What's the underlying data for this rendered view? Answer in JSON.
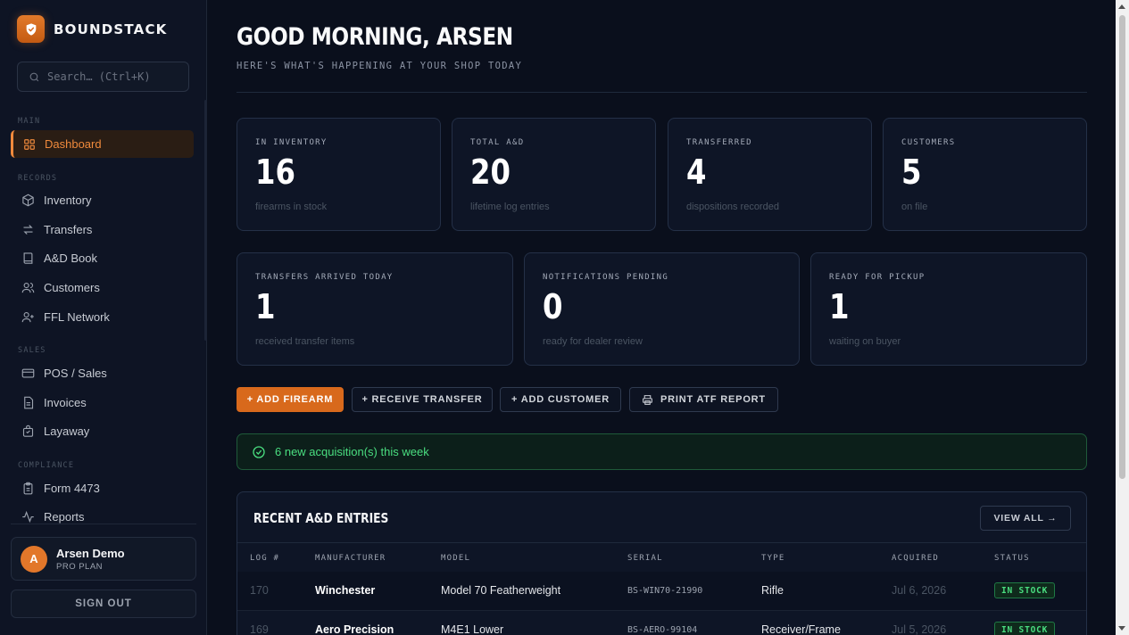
{
  "brand": {
    "name": "BOUNDSTACK"
  },
  "search": {
    "placeholder": "Search… (Ctrl+K)"
  },
  "sidebar": {
    "sections": {
      "main": "MAIN",
      "records": "RECORDS",
      "sales": "SALES",
      "compliance": "COMPLIANCE"
    },
    "items": {
      "dashboard": "Dashboard",
      "inventory": "Inventory",
      "transfers": "Transfers",
      "adbook": "A&D Book",
      "customers": "Customers",
      "ffl": "FFL Network",
      "pos": "POS / Sales",
      "invoices": "Invoices",
      "layaway": "Layaway",
      "form4473": "Form 4473",
      "reports": "Reports"
    },
    "user": {
      "initial": "A",
      "name": "Arsen Demo",
      "plan": "PRO PLAN"
    },
    "signout": "SIGN OUT"
  },
  "header": {
    "greeting": "GOOD MORNING, ARSEN",
    "subtitle": "HERE'S WHAT'S HAPPENING AT YOUR SHOP TODAY"
  },
  "stats": [
    {
      "label": "IN INVENTORY",
      "value": "16",
      "sub": "firearms in stock"
    },
    {
      "label": "TOTAL A&D",
      "value": "20",
      "sub": "lifetime log entries"
    },
    {
      "label": "TRANSFERRED",
      "value": "4",
      "sub": "dispositions recorded"
    },
    {
      "label": "CUSTOMERS",
      "value": "5",
      "sub": "on file"
    },
    {
      "label": "TRANSFERS ARRIVED TODAY",
      "value": "1",
      "sub": "received transfer items"
    },
    {
      "label": "NOTIFICATIONS PENDING",
      "value": "0",
      "sub": "ready for dealer review"
    },
    {
      "label": "READY FOR PICKUP",
      "value": "1",
      "sub": "waiting on buyer"
    }
  ],
  "actions": {
    "add_firearm": "+ ADD FIREARM",
    "receive_transfer": "+ RECEIVE TRANSFER",
    "add_customer": "+ ADD CUSTOMER",
    "print_atf": "PRINT ATF REPORT"
  },
  "alert": {
    "text": "6 new acquisition(s) this week"
  },
  "recent": {
    "title": "RECENT A&D ENTRIES",
    "view_all": "VIEW ALL →",
    "columns": [
      "LOG #",
      "MANUFACTURER",
      "MODEL",
      "SERIAL",
      "TYPE",
      "ACQUIRED",
      "STATUS"
    ],
    "rows": [
      [
        "170",
        "Winchester",
        "Model 70 Featherweight",
        "BS-WIN70-21990",
        "Rifle",
        "Jul 6, 2026",
        "IN STOCK"
      ],
      [
        "169",
        "Aero Precision",
        "M4E1 Lower",
        "BS-AERO-99104",
        "Receiver/Frame",
        "Jul 5, 2026",
        "IN STOCK"
      ]
    ]
  },
  "colors": {
    "accent": "#d8691c",
    "success": "#4ade80",
    "bg": "#0a0f1c"
  }
}
